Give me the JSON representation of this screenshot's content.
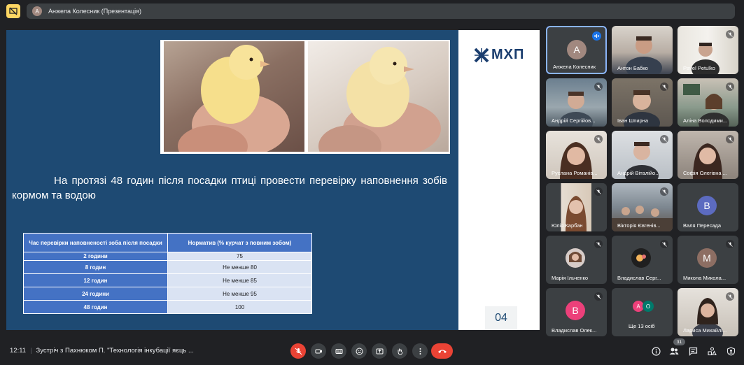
{
  "presentation": {
    "banner": "Анжела Колесник (Презентація)",
    "avatar_letter": "А"
  },
  "slide": {
    "logo": "МХП",
    "text": "На протязі 48 годин після посадки птиці провести перевірку наповнення зобів кормом та водою",
    "page_number": "04",
    "table": {
      "headers": [
        "Час перевірки наповненості зоба після посадки",
        "Норматив (% курчат з повним зобом)"
      ],
      "rows": [
        [
          "2 години",
          "75"
        ],
        [
          "8 годин",
          "Не менше 80"
        ],
        [
          "12 годин",
          "Не менше 85"
        ],
        [
          "24 години",
          "Не менше 95"
        ],
        [
          "48 годин",
          "100"
        ]
      ]
    }
  },
  "participants": [
    {
      "name": "Анжела Колесник",
      "letter": "А",
      "color": "#a1887f"
    },
    {
      "name": "Антон Бабко"
    },
    {
      "name": "Pavel Petulko"
    },
    {
      "name": "Андрій Сергійов..."
    },
    {
      "name": "Іван Шпирна"
    },
    {
      "name": "Аліна Володими..."
    },
    {
      "name": "Руслана Романів..."
    },
    {
      "name": "Андрій Віталійо..."
    },
    {
      "name": "Софія Олегівна ..."
    },
    {
      "name": "Юлія Карбан"
    },
    {
      "name": "Вікторія Євгенів..."
    },
    {
      "name": "Валя Пересада",
      "letter": "В",
      "color": "#5c6bc0"
    },
    {
      "name": "Марія Ільченко"
    },
    {
      "name": "Владислав Серг..."
    },
    {
      "name": "Микола Микола...",
      "letter": "М",
      "color": "#8d6e63"
    },
    {
      "name": "Владислав Олек...",
      "letter": "В",
      "color": "#ec407a"
    },
    {
      "name": "Ще 13 осіб",
      "letters": [
        "А",
        "О"
      ]
    },
    {
      "name": "Лариса Михайлі..."
    }
  ],
  "bottom": {
    "time": "12:11",
    "meeting_title": "Зустріч з Пахнюком П. \"Технологія інкубації яєць ...",
    "people_count": "31"
  },
  "colors": {
    "slide_bg": "#1e4a73",
    "table_header": "#4472c4",
    "table_cell": "#dae3f3",
    "hangup": "#ea4335",
    "active_border": "#8ab4f8"
  },
  "icons": [
    "present-off-icon",
    "mic-off-icon",
    "camera-icon",
    "captions-icon",
    "emoji-icon",
    "present-screen-icon",
    "raise-hand-icon",
    "more-icon",
    "hangup-icon",
    "info-icon",
    "people-icon",
    "chat-icon",
    "activities-icon",
    "host-controls-icon"
  ]
}
